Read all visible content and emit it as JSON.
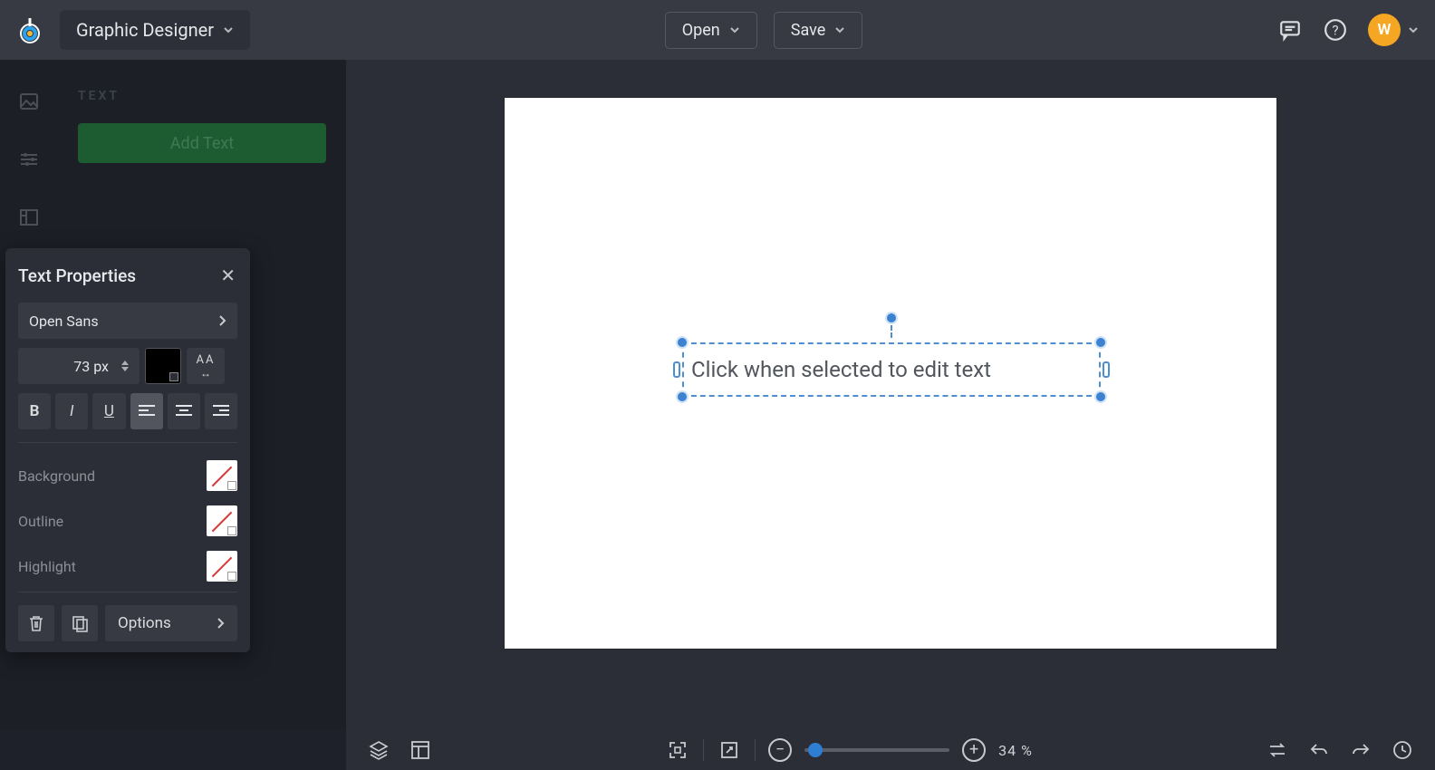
{
  "header": {
    "app_title": "Graphic Designer",
    "open_label": "Open",
    "save_label": "Save",
    "avatar_letter": "W"
  },
  "sidebar": {
    "section_label": "TEXT",
    "add_text_label": "Add Text"
  },
  "props": {
    "title": "Text Properties",
    "font_name": "Open Sans",
    "font_size": "73 px",
    "spacing_label": "AA",
    "bg_label": "Background",
    "outline_label": "Outline",
    "highlight_label": "Highlight",
    "options_label": "Options"
  },
  "canvas": {
    "placeholder_text": "Click when selected to edit text"
  },
  "bottombar": {
    "zoom_percent": "34 %"
  }
}
